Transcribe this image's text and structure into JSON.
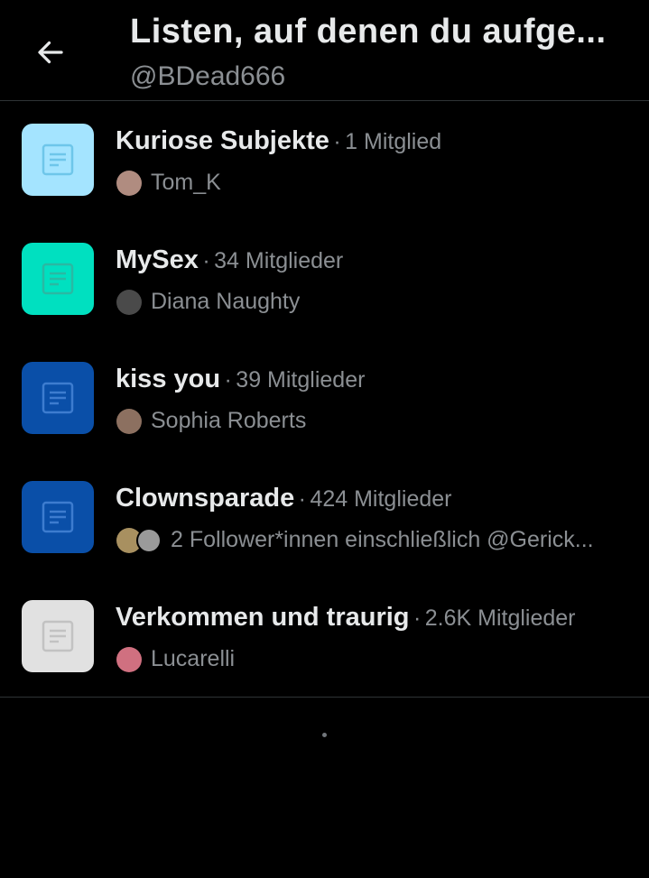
{
  "header": {
    "title": "Listen, auf denen du aufge...",
    "handle": "@BDead666",
    "back_icon": "arrow-left-icon"
  },
  "lists": [
    {
      "name": "Kuriose Subjekte",
      "separator": "·",
      "members": "1 Mitglied",
      "owner": "Tom_K",
      "icon_bg": "#a4e4ff",
      "icon_fg": "#6ec6ea",
      "avatars": [
        "#b08c80"
      ]
    },
    {
      "name": "MySex",
      "separator": "·",
      "members": "34 Mitglieder",
      "owner": "Diana Naughty",
      "icon_bg": "#00e0c0",
      "icon_fg": "#2ab9a3",
      "avatars": [
        "#4a4a4a"
      ]
    },
    {
      "name": "kiss you",
      "separator": "·",
      "members": "39 Mitglieder",
      "owner": "Sophia Roberts",
      "icon_bg": "#0a4fa8",
      "icon_fg": "#3d7ccf",
      "avatars": [
        "#8c7060"
      ]
    },
    {
      "name": "Clownsparade",
      "separator": "·",
      "members": "424 Mitglieder",
      "owner": "2 Follower*innen einschließlich @Gerick...",
      "icon_bg": "#0a4fa8",
      "icon_fg": "#3d7ccf",
      "avatars": [
        "#a89060",
        "#9a9a9a"
      ]
    },
    {
      "name": "Verkommen und traurig",
      "separator": "·",
      "members": "2.6K Mitglieder",
      "owner": "Lucarelli",
      "icon_bg": "#e1e1e1",
      "icon_fg": "#c2c2c2",
      "avatars": [
        "#d07080"
      ]
    }
  ]
}
